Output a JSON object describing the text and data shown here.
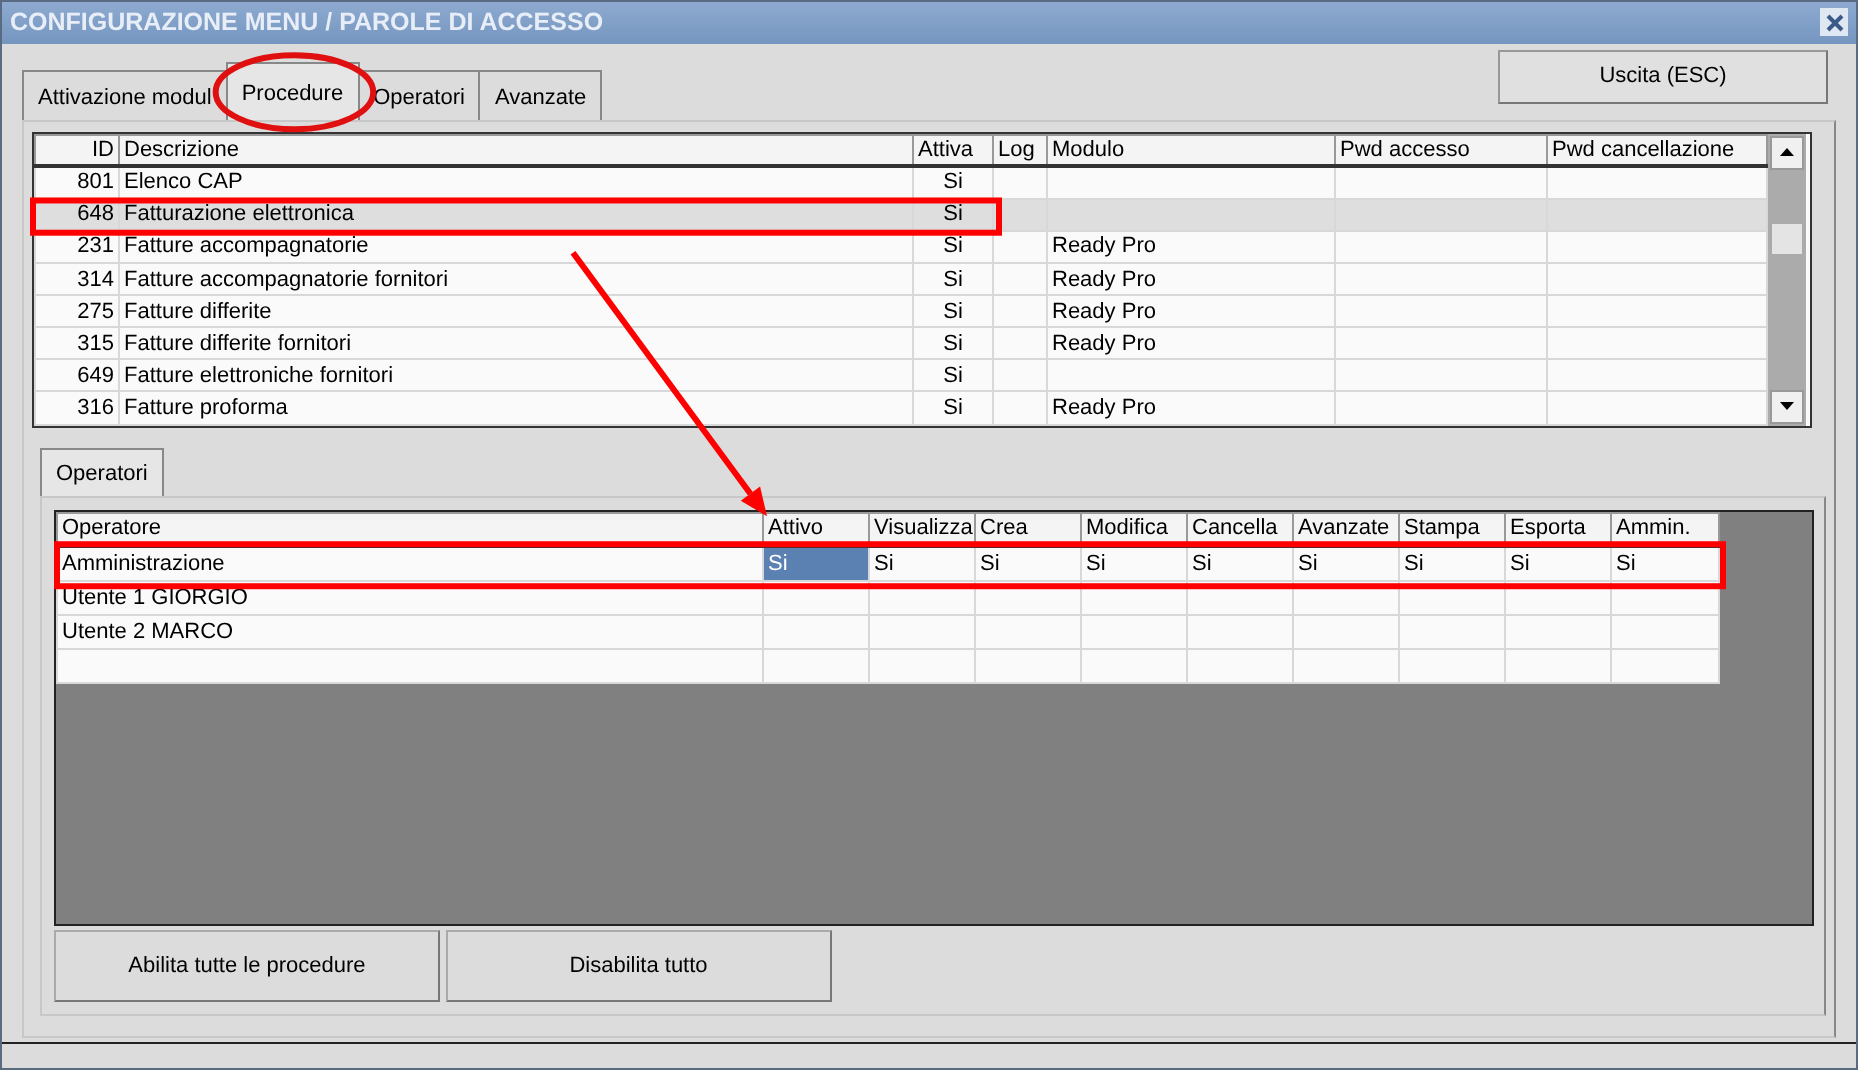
{
  "window": {
    "title": "CONFIGURAZIONE MENU / PAROLE DI ACCESSO"
  },
  "tabs": [
    {
      "label": "Attivazione modul",
      "selected": false
    },
    {
      "label": "Procedure",
      "selected": true
    },
    {
      "label": "Operatori",
      "selected": false
    },
    {
      "label": "Avanzate",
      "selected": false
    }
  ],
  "exit_button": "Uscita (ESC)",
  "procedures": {
    "columns": [
      "ID",
      "Descrizione",
      "Attiva",
      "Log",
      "Modulo",
      "Pwd accesso",
      "Pwd cancellazione"
    ],
    "rows": [
      {
        "id": "801",
        "descrizione": "Elenco CAP",
        "attiva": "Si",
        "selected": false
      },
      {
        "id": "648",
        "descrizione": "Fatturazione elettronica",
        "attiva": "Si",
        "selected": true
      },
      {
        "id": "231",
        "descrizione": "Fatture accompagnatorie",
        "attiva": "Si",
        "modulo": "Ready Pro",
        "selected": false
      },
      {
        "id": "314",
        "descrizione": "Fatture accompagnatorie fornitori",
        "attiva": "Si",
        "modulo": "Ready Pro",
        "selected": false
      },
      {
        "id": "275",
        "descrizione": "Fatture differite",
        "attiva": "Si",
        "modulo": "Ready Pro",
        "selected": false
      },
      {
        "id": "315",
        "descrizione": "Fatture differite fornitori",
        "attiva": "Si",
        "modulo": "Ready Pro",
        "selected": false
      },
      {
        "id": "649",
        "descrizione": "Fatture elettroniche fornitori",
        "attiva": "Si",
        "selected": false
      },
      {
        "id": "316",
        "descrizione": "Fatture proforma",
        "attiva": "Si",
        "modulo": "Ready Pro",
        "selected": false
      }
    ]
  },
  "sub_tabs": [
    {
      "label": "Operatori",
      "selected": true
    }
  ],
  "operators": {
    "columns": [
      "Operatore",
      "Attivo",
      "Visualizza",
      "Crea",
      "Modifica",
      "Cancella",
      "Avanzate",
      "Stampa",
      "Esporta",
      "Ammin."
    ],
    "rows": [
      {
        "operatore": "Amministrazione",
        "cells": [
          {
            "text": "Si",
            "selected": true
          },
          {
            "text": "Si",
            "selected": false
          },
          {
            "text": "Si",
            "selected": false
          },
          {
            "text": "Si",
            "selected": false
          },
          {
            "text": "Si",
            "selected": false
          },
          {
            "text": "Si",
            "selected": false
          },
          {
            "text": "Si",
            "selected": false
          },
          {
            "text": "Si",
            "selected": false
          },
          {
            "text": "Si",
            "selected": false
          }
        ]
      },
      {
        "operatore": "Utente 1 GIORGIO"
      },
      {
        "operatore": "Utente 2 MARCO"
      }
    ]
  },
  "buttons": [
    "Abilita tutte le procedure",
    "Disabilita tutto"
  ]
}
